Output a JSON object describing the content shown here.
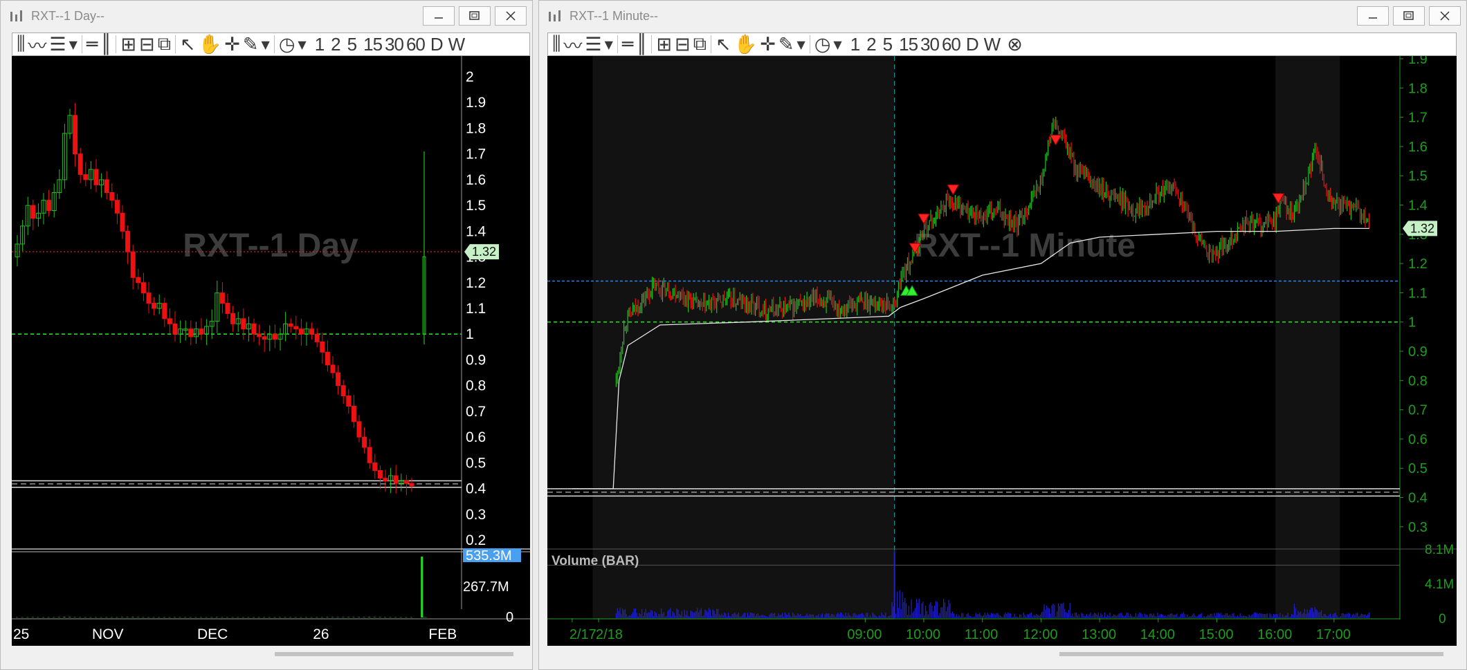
{
  "left": {
    "window_title": "RXT--1 Day--",
    "watermark": "RXT--1 Day",
    "toolbar_intervals": [
      "1",
      "2",
      "5",
      "15",
      "30",
      "60",
      "D",
      "W"
    ],
    "price_label": "1.32",
    "volume_labels": {
      "top": "535.3M",
      "mid": "267.7M",
      "zero": "0"
    },
    "colors": {
      "up": "#22c022",
      "down": "#ee1111",
      "price_line": "#dd2222",
      "support": "#22dd22",
      "volume": "#22dd22"
    }
  },
  "right": {
    "window_title": "RXT--1 Minute--",
    "watermark": "RXT--1 Minute",
    "toolbar_intervals": [
      "1",
      "2",
      "5",
      "15",
      "30",
      "60",
      "D",
      "W"
    ],
    "price_label": "1.32",
    "volume_title": "Volume (BAR)",
    "volume_labels": {
      "top": "8.1M",
      "mid": "4.1M",
      "zero": "0"
    },
    "colors": {
      "up": "#22c022",
      "down": "#ee1111",
      "vwap": "#e8e8e8",
      "blue_level": "#2288ee",
      "green_level": "#22dd22",
      "volume": "#2222cc",
      "axis": "#1f9c1f"
    }
  },
  "chart_data": [
    {
      "type": "candlestick",
      "title": "RXT--1 Day",
      "y_ticks": [
        0.2,
        0.3,
        0.4,
        0.5,
        0.6,
        0.7,
        0.8,
        0.9,
        1,
        1.1,
        1.2,
        1.3,
        1.4,
        1.5,
        1.6,
        1.7,
        1.8,
        1.9,
        2
      ],
      "ylim": [
        0.2,
        2.0
      ],
      "x_labels": [
        "25",
        "NOV",
        "DEC",
        "26",
        "FEB"
      ],
      "x_label_bar": [
        0,
        15,
        35,
        57,
        79
      ],
      "horizontal_levels": [
        {
          "price": 1.32,
          "style": "dotted-red"
        },
        {
          "price": 1.0,
          "style": "dashed-green"
        }
      ],
      "last_candle": {
        "open": 1.0,
        "close": 1.3,
        "high": 1.71,
        "low": 0.96
      },
      "volume_last": 535.3,
      "volume_unit": "M",
      "closes": [
        1.35,
        1.42,
        1.5,
        1.45,
        1.47,
        1.52,
        1.48,
        1.55,
        1.6,
        1.78,
        1.85,
        1.7,
        1.62,
        1.6,
        1.64,
        1.58,
        1.6,
        1.55,
        1.52,
        1.47,
        1.4,
        1.32,
        1.22,
        1.2,
        1.16,
        1.12,
        1.1,
        1.12,
        1.06,
        1.04,
        1.0,
        1.02,
        1.02,
        0.99,
        1.02,
        1.0,
        1.03,
        1.05,
        1.16,
        1.12,
        1.08,
        1.04,
        1.06,
        1.02,
        1.04,
        1.0,
        0.99,
        0.98,
        1.0,
        0.98,
        1.0,
        1.04,
        1.03,
        1.02,
        1.0,
        1.02,
        1.0,
        0.97,
        0.93,
        0.88,
        0.85,
        0.8,
        0.76,
        0.72,
        0.66,
        0.6,
        0.56,
        0.5,
        0.47,
        0.44,
        0.43,
        0.45,
        0.42,
        0.43,
        0.42,
        0.41
      ],
      "volumes": [
        2,
        2,
        2,
        3,
        2,
        2,
        2,
        2,
        3,
        5,
        4,
        3,
        2,
        2,
        2,
        2,
        2,
        2,
        2,
        2,
        3,
        3,
        4,
        3,
        2,
        2,
        2,
        2,
        2,
        2,
        2,
        2,
        2,
        2,
        2,
        2,
        2,
        2,
        3,
        2,
        2,
        2,
        2,
        2,
        2,
        2,
        2,
        2,
        2,
        2,
        2,
        2,
        2,
        2,
        2,
        2,
        2,
        2,
        2,
        3,
        3,
        3,
        3,
        3,
        3,
        3,
        3,
        4,
        3,
        3,
        2,
        2,
        2,
        2,
        2,
        2,
        2,
        535.3
      ]
    },
    {
      "type": "candlestick",
      "title": "RXT--1 Minute",
      "y_ticks": [
        0.3,
        0.4,
        0.5,
        0.6,
        0.7,
        0.8,
        0.9,
        1,
        1.1,
        1.2,
        1.3,
        1.4,
        1.5,
        1.6,
        1.7,
        1.8,
        1.9
      ],
      "ylim": [
        0.25,
        1.9
      ],
      "x_labels": [
        "2/17",
        "2/18",
        "09:00",
        "10:00",
        "11:00",
        "12:00",
        "13:00",
        "14:00",
        "15:00",
        "16:00",
        "17:00"
      ],
      "x_label_hours": [
        4.0,
        4.45,
        9.0,
        10.0,
        11.0,
        12.0,
        13.0,
        14.0,
        15.0,
        16.0,
        17.0
      ],
      "x_range_hours": [
        3.6,
        18.1
      ],
      "horizontal_levels": [
        {
          "price": 1.32,
          "style": "solid-white"
        },
        {
          "price": 1.14,
          "style": "dashed-blue"
        },
        {
          "price": 1.0,
          "style": "dashed-green"
        }
      ],
      "session_open_hour": 9.5,
      "price_path": [
        [
          4.0,
          0.43
        ],
        [
          4.45,
          0.43
        ],
        [
          4.7,
          0.44
        ],
        [
          4.75,
          0.8
        ],
        [
          4.9,
          1.0
        ],
        [
          5.1,
          1.05
        ],
        [
          5.4,
          1.12
        ],
        [
          5.8,
          1.1
        ],
        [
          6.2,
          1.05
        ],
        [
          6.6,
          1.08
        ],
        [
          7.0,
          1.06
        ],
        [
          7.4,
          1.04
        ],
        [
          7.8,
          1.05
        ],
        [
          8.2,
          1.08
        ],
        [
          8.6,
          1.05
        ],
        [
          9.0,
          1.07
        ],
        [
          9.4,
          1.06
        ],
        [
          9.5,
          1.05
        ],
        [
          9.6,
          1.15
        ],
        [
          9.8,
          1.22
        ],
        [
          10.0,
          1.32
        ],
        [
          10.2,
          1.36
        ],
        [
          10.4,
          1.42
        ],
        [
          10.6,
          1.4
        ],
        [
          10.8,
          1.37
        ],
        [
          11.0,
          1.36
        ],
        [
          11.3,
          1.38
        ],
        [
          11.6,
          1.33
        ],
        [
          12.0,
          1.48
        ],
        [
          12.2,
          1.68
        ],
        [
          12.4,
          1.62
        ],
        [
          12.6,
          1.52
        ],
        [
          12.8,
          1.49
        ],
        [
          13.0,
          1.45
        ],
        [
          13.3,
          1.43
        ],
        [
          13.6,
          1.38
        ],
        [
          14.0,
          1.44
        ],
        [
          14.3,
          1.46
        ],
        [
          14.6,
          1.32
        ],
        [
          14.9,
          1.22
        ],
        [
          15.2,
          1.28
        ],
        [
          15.5,
          1.34
        ],
        [
          15.8,
          1.33
        ],
        [
          16.0,
          1.35
        ],
        [
          16.1,
          1.42
        ],
        [
          16.3,
          1.36
        ],
        [
          16.5,
          1.45
        ],
        [
          16.7,
          1.6
        ],
        [
          16.9,
          1.42
        ],
        [
          17.1,
          1.4
        ],
        [
          17.4,
          1.38
        ],
        [
          17.6,
          1.33
        ]
      ],
      "vwap_path": [
        [
          4.0,
          0.43
        ],
        [
          4.7,
          0.43
        ],
        [
          4.8,
          0.8
        ],
        [
          4.95,
          0.92
        ],
        [
          5.5,
          0.99
        ],
        [
          7.0,
          1.0
        ],
        [
          9.4,
          1.02
        ],
        [
          9.6,
          1.05
        ],
        [
          10.0,
          1.08
        ],
        [
          10.5,
          1.12
        ],
        [
          11.0,
          1.16
        ],
        [
          12.0,
          1.2
        ],
        [
          12.5,
          1.27
        ],
        [
          13.0,
          1.29
        ],
        [
          14.0,
          1.3
        ],
        [
          15.0,
          1.31
        ],
        [
          16.0,
          1.31
        ],
        [
          17.0,
          1.32
        ],
        [
          17.6,
          1.32
        ]
      ],
      "buy_signals": [
        [
          9.7,
          1.11
        ],
        [
          9.8,
          1.11
        ]
      ],
      "sell_signals": [
        [
          9.85,
          1.25
        ],
        [
          10.0,
          1.35
        ],
        [
          10.5,
          1.45
        ],
        [
          12.25,
          1.62
        ],
        [
          16.05,
          1.42
        ]
      ],
      "volume_ylim_millions": [
        0,
        8.1
      ]
    }
  ]
}
